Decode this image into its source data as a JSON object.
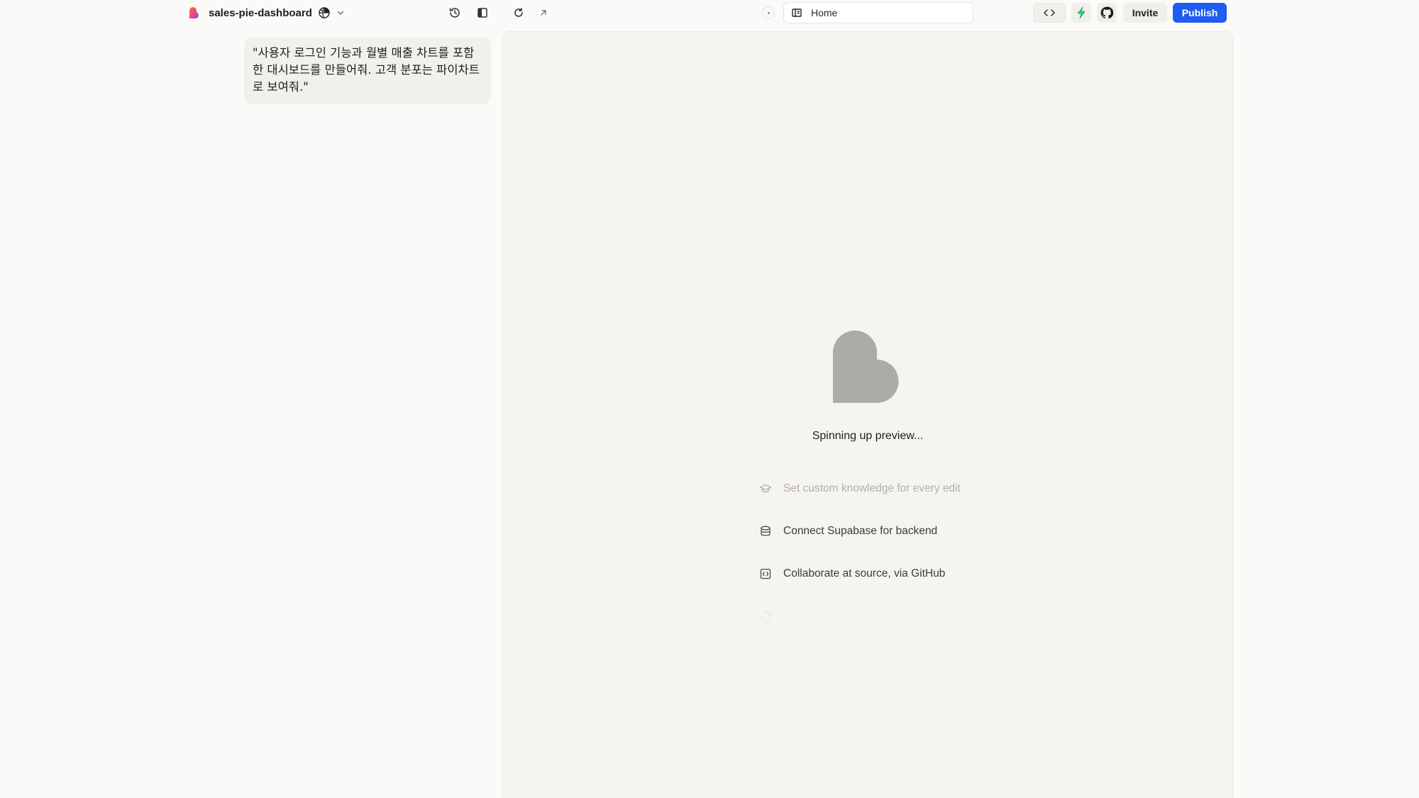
{
  "header": {
    "project_name": "sales-pie-dashboard",
    "invite_label": "Invite",
    "publish_label": "Publish",
    "url_path": "Home",
    "brand_colors": {
      "publish_bg": "#1f5cf0",
      "bolt": "#2ecc71"
    }
  },
  "chat": {
    "messages": [
      {
        "role": "user",
        "text": "\"사용자 로그인 기능과 월별 매출 차트를 포함한 대시보드를 만들어줘. 고객 분포는 파이차트로 보여줘.\""
      }
    ]
  },
  "preview": {
    "status_text": "Spinning up preview...",
    "tips": [
      {
        "icon": "graduation-cap-icon",
        "label": "Set custom knowledge for every edit"
      },
      {
        "icon": "database-icon",
        "label": "Connect Supabase for backend"
      },
      {
        "icon": "github-box-icon",
        "label": "Collaborate at source, via GitHub"
      },
      {
        "icon": "loader-icon",
        "label": ""
      }
    ]
  }
}
